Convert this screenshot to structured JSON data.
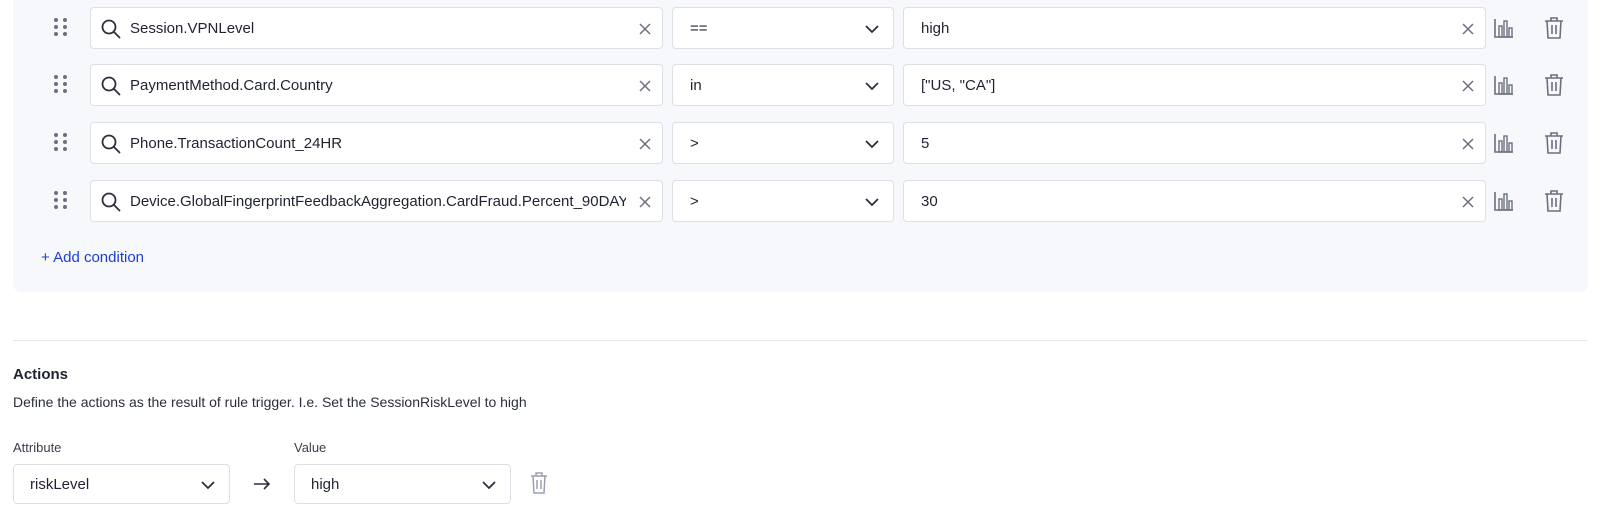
{
  "conditions": [
    {
      "attribute": "Session.VPNLevel",
      "operator": "==",
      "value": "high"
    },
    {
      "attribute": "PaymentMethod.Card.Country",
      "operator": "in",
      "value": "[\"US, \"CA\"]"
    },
    {
      "attribute": "Phone.TransactionCount_24HR",
      "operator": ">",
      "value": "5"
    },
    {
      "attribute": "Device.GlobalFingerprintFeedbackAggregation.CardFraud.Percent_90DAY",
      "operator": ">",
      "value": "30"
    }
  ],
  "add_condition_label": "+ Add condition",
  "actions": {
    "title": "Actions",
    "description": "Define the actions as the result of rule trigger. I.e. Set the SessionRiskLevel to high",
    "attribute_label": "Attribute",
    "value_label": "Value",
    "attribute_value": "riskLevel",
    "value_value": "high"
  },
  "colors": {
    "panel_bg": "#f7f8fb",
    "link": "#1f3dd6",
    "border": "#dcdfe6",
    "icon": "#6b7080"
  },
  "icons": [
    "drag-handle-icon",
    "search-icon",
    "clear-icon",
    "chevron-down-icon",
    "bar-chart-icon",
    "trash-icon",
    "arrow-right-icon"
  ]
}
